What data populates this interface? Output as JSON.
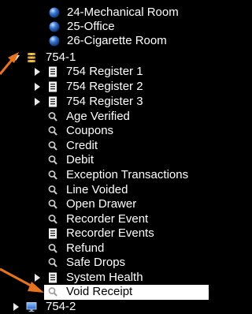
{
  "tree": {
    "room_24": "24-Mechanical Room",
    "room_25": "25-Office",
    "room_26": "26-Cigarette Room",
    "node_754_1": "754-1",
    "register_1": "754 Register 1",
    "register_2": "754 Register 2",
    "register_3": "754 Register 3",
    "age_verified": "Age Verified",
    "coupons": "Coupons",
    "credit": "Credit",
    "debit": "Debit",
    "exception_transactions": "Exception Transactions",
    "line_voided": "Line Voided",
    "open_drawer": "Open Drawer",
    "recorder_event": "Recorder Event",
    "recorder_events": "Recorder Events",
    "refund": "Refund",
    "safe_drops": "Safe Drops",
    "system_health": "System Health",
    "void_receipt": "Void Receipt",
    "node_754_2": "754-2"
  },
  "icons": {
    "camera": "camera-globe-icon",
    "group": "stack-icon",
    "register": "register-document-icon",
    "search": "search-magnifier-icon",
    "monitor": "monitor-icon"
  },
  "colors": {
    "background": "#000000",
    "text": "#ffffff",
    "selection": "#ffffff",
    "callout_arrow": "#e8731e",
    "camera_blue": "#3a78d8",
    "group_yellow": "#e8b820"
  }
}
